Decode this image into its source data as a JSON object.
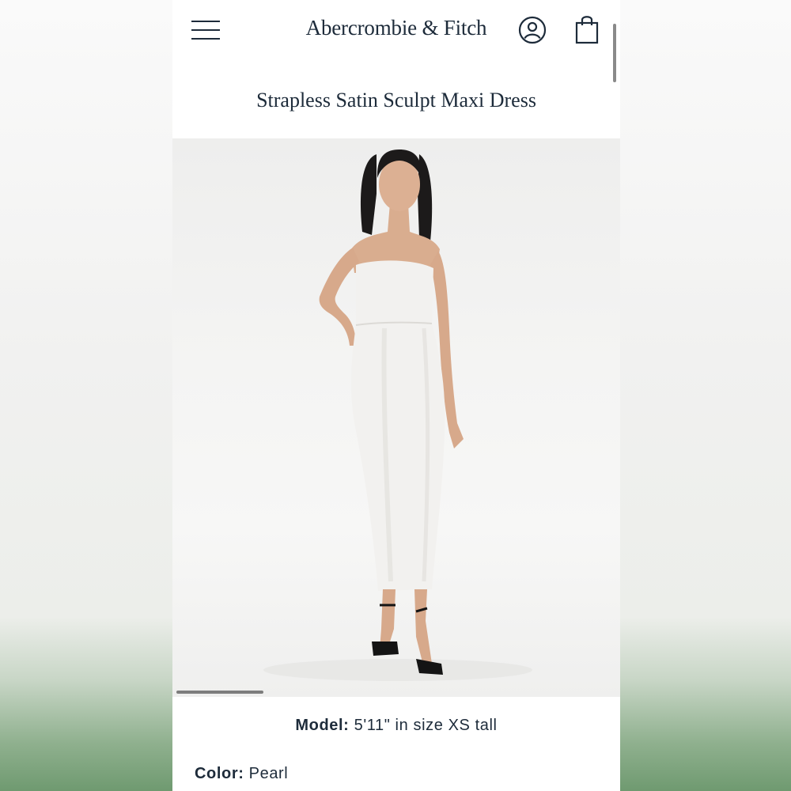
{
  "header": {
    "brand": "Abercrombie & Fitch",
    "menu_icon": "hamburger-menu-icon",
    "account_icon": "account-icon",
    "bag_icon": "shopping-bag-icon"
  },
  "product": {
    "title": "Strapless Satin Sculpt Maxi Dress",
    "model_label": "Model:",
    "model_value": "5'11\" in size XS tall",
    "color_label": "Color:",
    "color_value": "Pearl"
  },
  "colors": {
    "text": "#1d2b3a",
    "dress": "#f2f1ef",
    "background_green": "#6f9a70"
  }
}
